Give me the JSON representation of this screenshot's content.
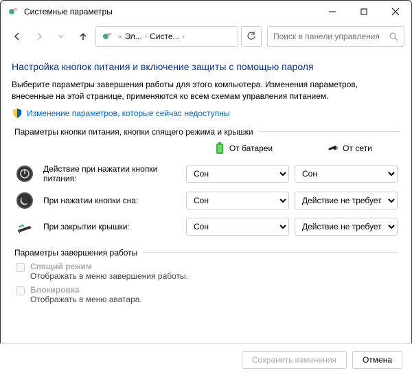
{
  "window": {
    "title": "Системные параметры"
  },
  "breadcrumb": {
    "item1": "Эл...",
    "item2": "Систе..."
  },
  "search": {
    "placeholder": "Поиск в панели управления"
  },
  "page": {
    "heading": "Настройка кнопок питания и включение защиты с помощью пароля",
    "desc": "Выберите параметры завершения работы для этого компьютера. Изменения параметров, внесенные на этой странице, применяются ко всем схемам управления питанием.",
    "link": "Изменение параметров, которые сейчас недоступны"
  },
  "group": {
    "legend": "Параметры кнопки питания, кнопки спящего режима и крышки",
    "col_battery": "От батареи",
    "col_ac": "От сети",
    "rows": [
      {
        "label": "Действие при нажатии кнопки питания:",
        "battery": "Сон",
        "ac": "Сон"
      },
      {
        "label": "При нажатии кнопки сна:",
        "battery": "Сон",
        "ac": "Действие не требуется"
      },
      {
        "label": "При закрытии крышки:",
        "battery": "Сон",
        "ac": "Действие не требуется"
      }
    ]
  },
  "shutdown": {
    "legend": "Параметры завершения работы",
    "opts": [
      {
        "title": "Спящий режим",
        "desc": "Отображать в меню завершения работы."
      },
      {
        "title": "Блокировка",
        "desc": "Отображать в меню аватара."
      }
    ]
  },
  "footer": {
    "save": "Сохранить изменения",
    "cancel": "Отмена"
  }
}
